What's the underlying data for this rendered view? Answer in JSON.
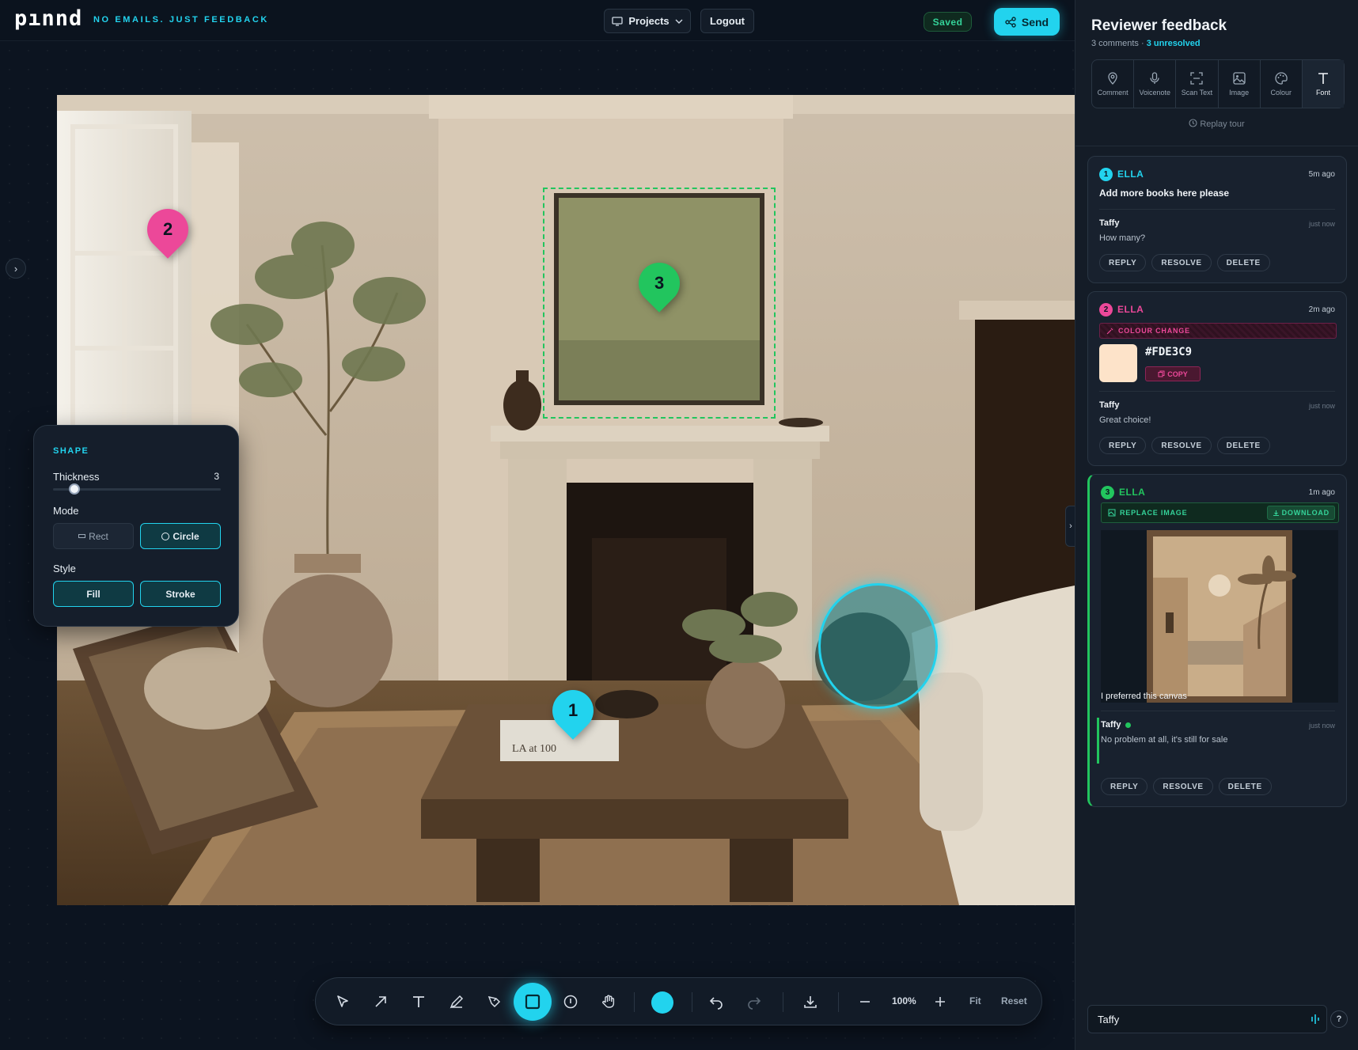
{
  "header": {
    "logo": "pınnd",
    "tagline": "NO EMAILS. JUST FEEDBACK",
    "projects_label": "Projects",
    "logout_label": "Logout",
    "saved_label": "Saved",
    "send_label": "Send"
  },
  "canvas": {
    "pins": [
      {
        "number": "1",
        "color": "#22d3ee"
      },
      {
        "number": "2",
        "color": "#ec4899"
      },
      {
        "number": "3",
        "color": "#22c55e"
      }
    ],
    "book_text": "LA at 100"
  },
  "shape_panel": {
    "title": "SHAPE",
    "thickness_label": "Thickness",
    "thickness_value": "3",
    "mode_label": "Mode",
    "rect_label": "Rect",
    "circle_label": "Circle",
    "style_label": "Style",
    "fill_label": "Fill",
    "stroke_label": "Stroke"
  },
  "toolbar": {
    "tools": [
      "select-icon",
      "arrow-icon",
      "text-icon",
      "pen-icon",
      "marker-icon",
      "shape-icon",
      "pin-icon",
      "hand-icon"
    ],
    "active_tool": "shape-icon",
    "color": "#22d3ee",
    "zoom": "100%",
    "fit_label": "Fit",
    "reset_label": "Reset"
  },
  "panel": {
    "title": "Reviewer feedback",
    "comment_count": "3 comments",
    "separator": " · ",
    "unresolved": "3 unresolved",
    "tools": [
      {
        "label": "Comment",
        "icon": "location-pin-icon"
      },
      {
        "label": "Voicenote",
        "icon": "microphone-icon"
      },
      {
        "label": "Scan Text",
        "icon": "scan-icon"
      },
      {
        "label": "Image",
        "icon": "image-icon"
      },
      {
        "label": "Colour",
        "icon": "palette-icon"
      },
      {
        "label": "Font",
        "icon": "font-icon"
      }
    ],
    "replay_label": "Replay tour",
    "actions": {
      "reply": "REPLY",
      "resolve": "RESOLVE",
      "delete": "DELETE"
    },
    "comments": [
      {
        "number": "1",
        "author": "ELLA",
        "time": "5m ago",
        "color": "#22d3ee",
        "text": "Add more books here please",
        "reply": {
          "author": "Taffy",
          "time": "just now",
          "text": "How many?"
        }
      },
      {
        "number": "2",
        "author": "ELLA",
        "time": "2m ago",
        "color": "#ec4899",
        "tag": "COLOUR CHANGE",
        "hex": "#FDE3C9",
        "copy_label": "COPY",
        "reply": {
          "author": "Taffy",
          "time": "just now",
          "text": "Great choice!"
        }
      },
      {
        "number": "3",
        "author": "ELLA",
        "time": "1m ago",
        "color": "#22c55e",
        "tag": "REPLACE IMAGE",
        "download_label": "DOWNLOAD",
        "text": "I preferred this canvas",
        "reply": {
          "author": "Taffy",
          "time": "just now",
          "text": "No problem at all, it's still for sale"
        }
      }
    ],
    "input_value": "Taffy",
    "help_label": "?"
  }
}
